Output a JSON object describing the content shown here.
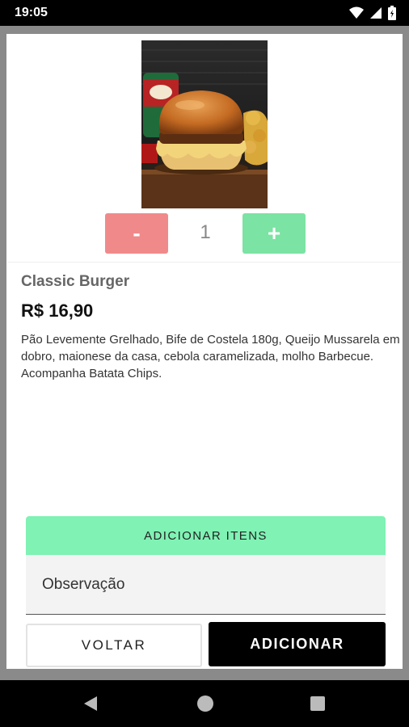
{
  "status_bar": {
    "time": "19:05",
    "icons": [
      "wifi-icon",
      "signal-icon",
      "battery-icon"
    ]
  },
  "product": {
    "image": "burger-photo",
    "quantity": "1",
    "minus_label": "-",
    "plus_label": "+",
    "name": "Classic Burger",
    "price": "R$ 16,90",
    "description": "Pão Levemente Grelhado, Bife de Costela 180g, Queijo Mussarela em dobro, maionese da casa, cebola caramelizada, molho Barbecue. Acompanha Batata Chips."
  },
  "extras": {
    "add_items_label": "ADICIONAR ITENS",
    "observation_placeholder": "Observação"
  },
  "actions": {
    "back_label": "VOLTAR",
    "add_label": "ADICIONAR"
  },
  "colors": {
    "minus": "#f08a8a",
    "plus": "#7be3a3",
    "add_items": "#7ff2b4",
    "primary": "#000000"
  }
}
